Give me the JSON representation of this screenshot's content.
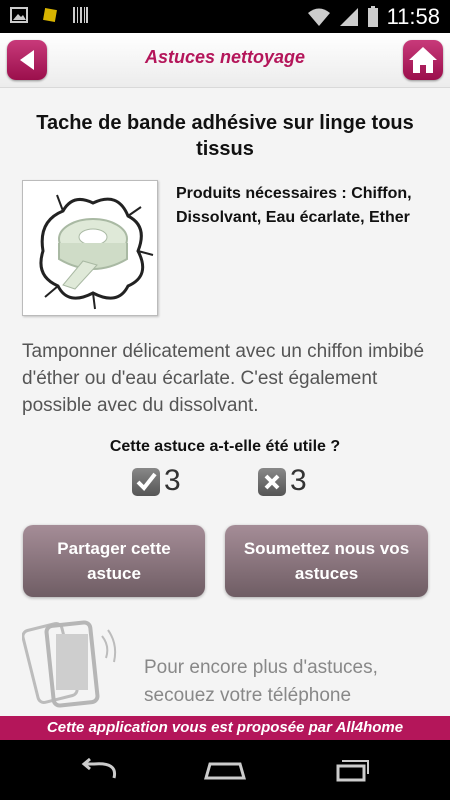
{
  "status_bar": {
    "time": "11:58",
    "left_icons": [
      "picture-icon",
      "notification-icon",
      "barcode-icon"
    ],
    "right_icons": [
      "wifi-icon",
      "signal-icon",
      "battery-icon"
    ]
  },
  "header": {
    "title": "Astuces nettoyage"
  },
  "tip": {
    "title": "Tache de bande adhésive sur linge tous tissus",
    "products": "Produits nécessaires : Chiffon, Dissolvant, Eau écarlate, Ether",
    "description": "Tamponner délicatement avec un chiffon imbibé d'éther ou d'eau écarlate. C'est également possible avec du dissolvant."
  },
  "vote": {
    "question": "Cette astuce a-t-elle été utile ?",
    "yes_count": "3",
    "no_count": "3"
  },
  "buttons": {
    "share": "Partager cette astuce",
    "submit": "Soumettez nous vos astuces"
  },
  "shake_hint": "Pour encore plus d'astuces, secouez votre téléphone",
  "footer": "Cette application vous est proposée par All4home",
  "colors": {
    "accent": "#b4165a",
    "button": "#7d6a71"
  }
}
